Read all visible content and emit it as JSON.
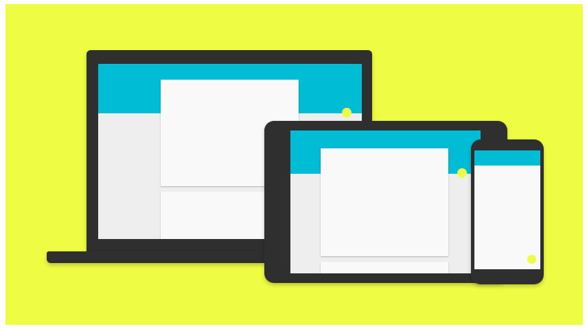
{
  "scene": {
    "background_color": "#eefc43",
    "device_color": "#2f2f2f",
    "toolbar_color": "#00bcd4",
    "surface_color": "#f9f9f9",
    "canvas_color": "#eeeeee",
    "fab_color": "#eefc43"
  },
  "devices": [
    {
      "type": "laptop",
      "label": ""
    },
    {
      "type": "tablet",
      "label": ""
    },
    {
      "type": "phone",
      "label": ""
    }
  ]
}
